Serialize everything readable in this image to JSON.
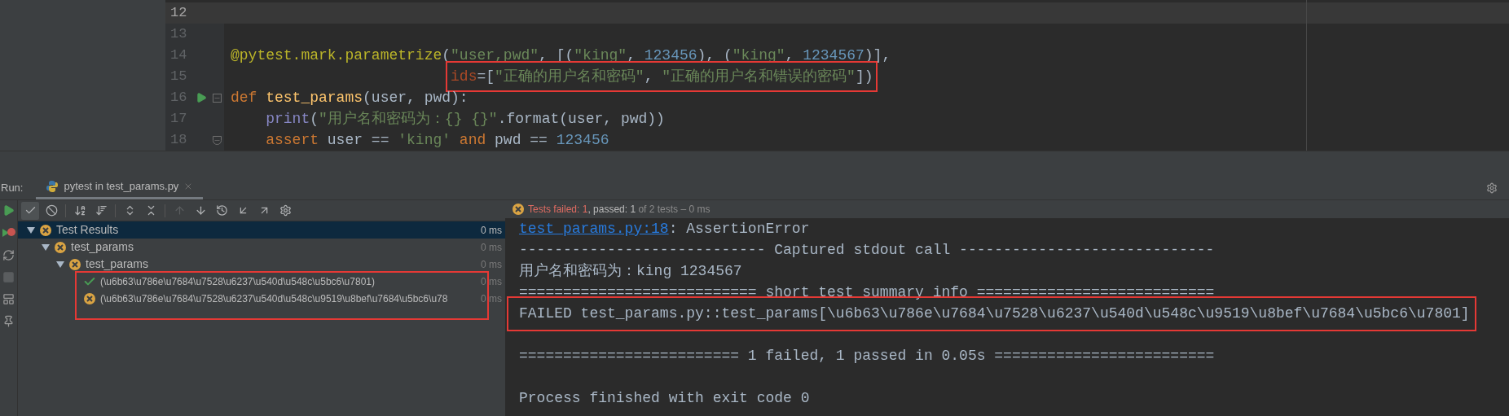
{
  "editor": {
    "lines": [
      {
        "number": "12",
        "current": true,
        "runnable": false,
        "fold_start": false,
        "fold_end": false,
        "annotated": false,
        "kind": "top"
      },
      {
        "number": "13",
        "current": false,
        "runnable": false,
        "fold_start": false,
        "fold_end": false,
        "annotated": false,
        "kind": "top"
      },
      {
        "number": "14",
        "current": false,
        "runnable": false,
        "fold_start": false,
        "fold_end": false,
        "annotated": false,
        "kind": "top",
        "tokens": [
          {
            "kind": "decorator",
            "text": "@pytest.mark.parametrize"
          },
          {
            "kind": "plain",
            "text": "("
          },
          {
            "kind": "string",
            "text": "\"user,pwd\""
          },
          {
            "kind": "plain",
            "text": ", [("
          },
          {
            "kind": "string",
            "text": "\"king\""
          },
          {
            "kind": "plain",
            "text": ", "
          },
          {
            "kind": "number",
            "text": "123456"
          },
          {
            "kind": "plain",
            "text": "), ("
          },
          {
            "kind": "string",
            "text": "\"king\""
          },
          {
            "kind": "plain",
            "text": ", "
          },
          {
            "kind": "number",
            "text": "1234567"
          },
          {
            "kind": "plain",
            "text": ")],"
          }
        ]
      },
      {
        "number": "15",
        "current": false,
        "runnable": false,
        "fold_start": false,
        "fold_end": false,
        "annotated": true,
        "kind": "continuation",
        "tokens": [
          {
            "kind": "kwarg",
            "text": "ids"
          },
          {
            "kind": "plain",
            "text": "=["
          },
          {
            "kind": "string",
            "text": "\"正确的用户名和密码\""
          },
          {
            "kind": "plain",
            "text": ", "
          },
          {
            "kind": "string",
            "text": "\"正确的用户名和错误的密码\""
          },
          {
            "kind": "plain",
            "text": "])"
          }
        ]
      },
      {
        "number": "16",
        "current": false,
        "runnable": true,
        "fold_start": true,
        "fold_end": false,
        "annotated": false,
        "kind": "top",
        "tokens": [
          {
            "kind": "keyword",
            "text": "def"
          },
          {
            "kind": "function",
            "text": " test_params"
          },
          {
            "kind": "plain",
            "text": "(user, pwd):"
          }
        ]
      },
      {
        "number": "17",
        "current": false,
        "runnable": false,
        "fold_start": false,
        "fold_end": false,
        "annotated": false,
        "kind": "body",
        "tokens": [
          {
            "kind": "builtin",
            "text": "print"
          },
          {
            "kind": "plain",
            "text": "("
          },
          {
            "kind": "string",
            "text": "\"用户名和密码为：{} {}\""
          },
          {
            "kind": "plain",
            "text": ".format(user, pwd))"
          }
        ]
      },
      {
        "number": "18",
        "current": false,
        "runnable": false,
        "fold_start": false,
        "fold_end": true,
        "annotated": false,
        "kind": "body",
        "tokens": [
          {
            "kind": "keyword",
            "text": "assert"
          },
          {
            "kind": "plain",
            "text": " user == "
          },
          {
            "kind": "string",
            "text": "'king'"
          },
          {
            "kind": "keyword",
            "text": " and"
          },
          {
            "kind": "plain",
            "text": " pwd == "
          },
          {
            "kind": "number",
            "text": "123456"
          }
        ]
      }
    ]
  },
  "run_panel": {
    "label": "Run:",
    "tabs": [
      {
        "label": "pytest in test_params.py",
        "selected": true
      }
    ],
    "side_tools": [
      {
        "kind": "rerun"
      },
      {
        "kind": "rerun-failed"
      },
      {
        "kind": "auto-test"
      },
      {
        "kind": "stop"
      },
      {
        "kind": "layout"
      },
      {
        "kind": "pin"
      }
    ],
    "toolbar": [
      {
        "kind": "show-passed",
        "selected": true,
        "disabled": false
      },
      {
        "kind": "show-ignored",
        "selected": false,
        "disabled": false
      },
      {
        "kind": "sort-alpha",
        "selected": false,
        "disabled": false
      },
      {
        "kind": "sort-duration",
        "selected": false,
        "disabled": false
      },
      {
        "kind": "expand-all",
        "selected": false,
        "disabled": false
      },
      {
        "kind": "collapse-all",
        "selected": false,
        "disabled": false
      },
      {
        "kind": "previous",
        "selected": false,
        "disabled": true
      },
      {
        "kind": "next",
        "selected": false,
        "disabled": false
      },
      {
        "kind": "history",
        "selected": false,
        "disabled": false
      },
      {
        "kind": "import",
        "selected": false,
        "disabled": false
      },
      {
        "kind": "export",
        "selected": false,
        "disabled": false
      },
      {
        "kind": "settings",
        "selected": false,
        "disabled": false
      }
    ],
    "tree": [
      {
        "label": "Test Results",
        "passed": false,
        "time": "0 ms",
        "selected": true,
        "expanded": true,
        "annotated_children": false,
        "children": [
          {
            "label": "test_params",
            "passed": false,
            "time": "0 ms",
            "selected": false,
            "expanded": true,
            "annotated_children": false,
            "children": [
              {
                "label": "test_params",
                "passed": false,
                "time": "0 ms",
                "selected": false,
                "expanded": true,
                "annotated_children": true,
                "children": [
                  {
                    "label": "(\\u6b63\\u786e\\u7684\\u7528\\u6237\\u540d\\u548c\\u5bc6\\u7801)",
                    "passed": true,
                    "time": "0 ms",
                    "selected": false
                  },
                  {
                    "label": "(\\u6b63\\u786e\\u7684\\u7528\\u6237\\u540d\\u548c\\u9519\\u8bef\\u7684\\u5bc6\\u78",
                    "passed": false,
                    "time": "0 ms",
                    "selected": false
                  }
                ]
              }
            ]
          }
        ]
      }
    ],
    "status": {
      "failed": "Tests failed: 1",
      "passed": ", passed: 1",
      "summary": " of 2 tests – 0 ms"
    },
    "output": [
      {
        "kind": "link",
        "link": "test_params.py:18",
        "text": ": AssertionError"
      },
      {
        "kind": "text",
        "text": "---------------------------- Captured stdout call -----------------------------"
      },
      {
        "kind": "text",
        "text": "用户名和密码为：king 1234567"
      },
      {
        "kind": "text",
        "text": "=========================== short test summary info ==========================="
      },
      {
        "kind": "framed",
        "text": "FAILED test_params.py::test_params[\\u6b63\\u786e\\u7684\\u7528\\u6237\\u540d\\u548c\\u9519\\u8bef\\u7684\\u5bc6\\u7801]"
      },
      {
        "kind": "blank"
      },
      {
        "kind": "text",
        "text": "========================= 1 failed, 1 passed in 0.05s ========================="
      },
      {
        "kind": "blank"
      },
      {
        "kind": "text",
        "text": "Process finished with exit code 0"
      }
    ]
  }
}
